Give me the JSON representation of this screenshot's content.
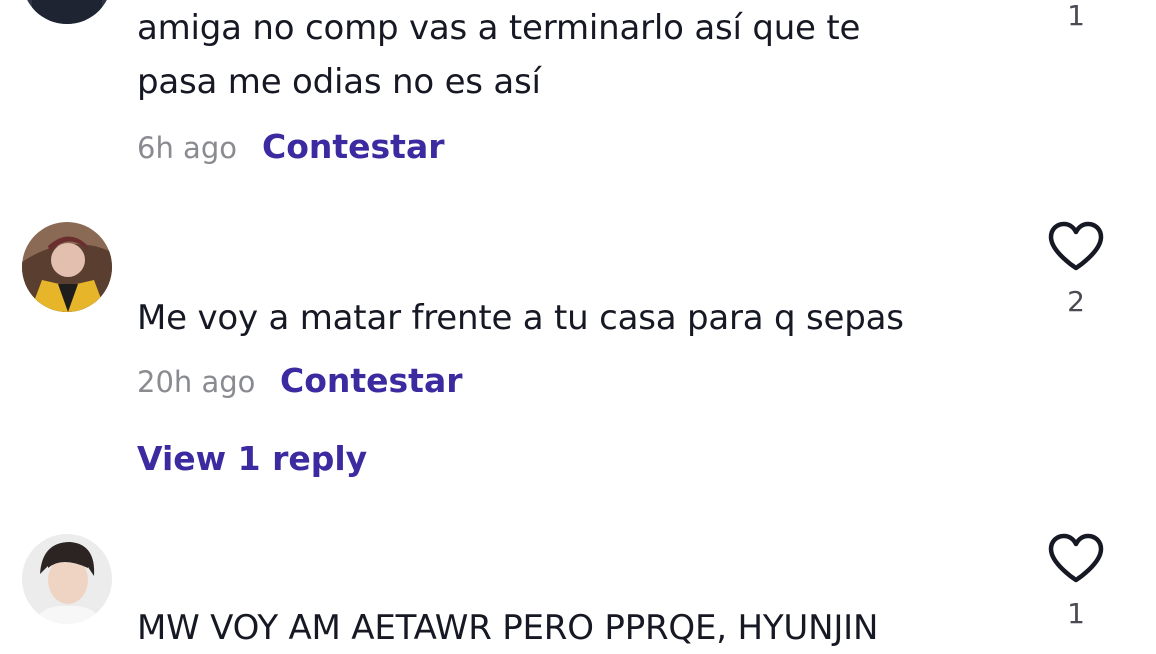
{
  "comments": [
    {
      "text_line1": "amiga no comp vas a terminarlo así que te",
      "text_line2": "pasa me odias no es así",
      "time": "6h ago",
      "reply_label": "Contestar",
      "likes": "1"
    },
    {
      "text": "Me voy a matar frente a tu casa para q sepas",
      "time": "20h ago",
      "reply_label": "Contestar",
      "view_replies": "View 1 reply",
      "likes": "2"
    },
    {
      "text": "MW VOY AM AETAWR PERO PPRQE, HYUNJIN",
      "likes": "1"
    }
  ],
  "colors": {
    "link": "#3b2aa0",
    "meta": "#8a8b91",
    "text": "#161823"
  },
  "icons": [
    "heart-outline-icon",
    "user-avatar"
  ]
}
